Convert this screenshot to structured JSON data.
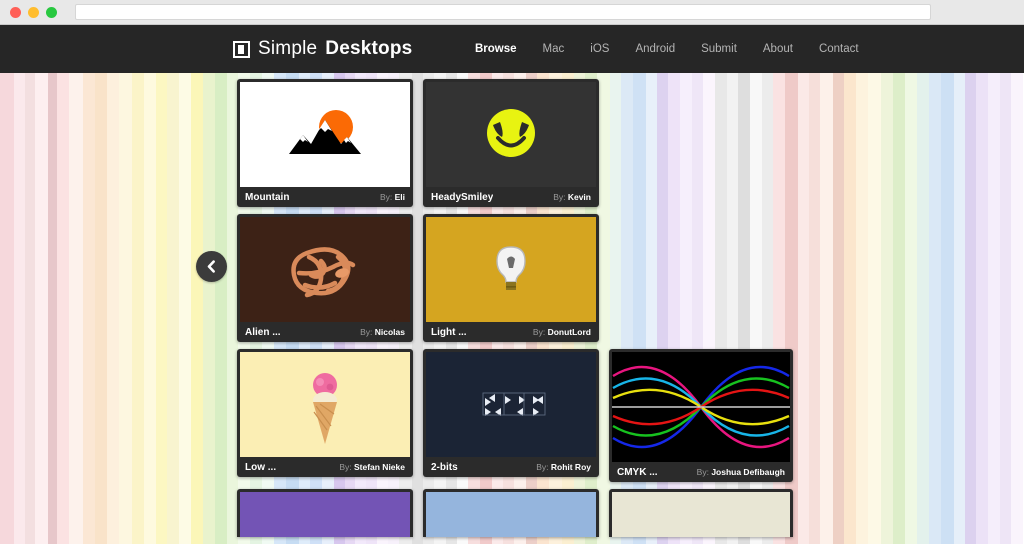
{
  "browser": {
    "traffic_lights": [
      "close",
      "minimize",
      "zoom"
    ],
    "address_value": "",
    "address_placeholder": ""
  },
  "nav": {
    "brand_light": "Simple",
    "brand_bold": "Desktops",
    "brand_icon": "square-window-icon",
    "links": [
      {
        "label": "Browse",
        "active": true
      },
      {
        "label": "Mac",
        "active": false
      },
      {
        "label": "iOS",
        "active": false
      },
      {
        "label": "Android",
        "active": false
      },
      {
        "label": "Submit",
        "active": false
      },
      {
        "label": "About",
        "active": false
      },
      {
        "label": "Contact",
        "active": false
      }
    ]
  },
  "controls": {
    "prev_icon": "chevron-left-icon",
    "prev_label": "Previous"
  },
  "gallery": {
    "by_prefix": "By: ",
    "rows": [
      {
        "items": [
          {
            "title": "Mountain",
            "author": "Eli",
            "art": "mountain",
            "bg": "#ffffff"
          },
          {
            "title": "HeadySmiley",
            "author": "Kevin",
            "art": "smiley",
            "bg": "#333333"
          }
        ]
      },
      {
        "items": [
          {
            "title": "Alien ...",
            "author": "Nicolas",
            "art": "alien",
            "bg": "#3d2216"
          },
          {
            "title": "Light ...",
            "author": "DonutLord",
            "art": "bulb",
            "bg": "#d5a520"
          }
        ]
      },
      {
        "items": [
          {
            "title": "Low ...",
            "author": "Stefan Nieke",
            "art": "icecream",
            "bg": "#fbeeb4"
          },
          {
            "title": "2-bits",
            "author": "Rohit Roy",
            "art": "bits",
            "bg": "#1b2435"
          },
          {
            "title": "CMYK ...",
            "author": "Joshua Defibaugh",
            "art": "cmyk",
            "bg": "#000000"
          }
        ]
      },
      {
        "items": [
          {
            "title": "",
            "author": "",
            "art": "solid",
            "bg": "#7354b5"
          },
          {
            "title": "",
            "author": "",
            "art": "solid",
            "bg": "#95b5dd"
          },
          {
            "title": "",
            "author": "",
            "art": "solid",
            "bg": "#e8e6d4"
          }
        ]
      }
    ]
  },
  "background": {
    "description": "pastel vertical stripes",
    "stripes": [
      {
        "c": "#f6d8dc",
        "w": 14
      },
      {
        "c": "#fbe9ec",
        "w": 10
      },
      {
        "c": "#f3dfe0",
        "w": 10
      },
      {
        "c": "#fdeff0",
        "w": 13
      },
      {
        "c": "#e7c7ca",
        "w": 9
      },
      {
        "c": "#fbe2e2",
        "w": 11
      },
      {
        "c": "#fdf2ec",
        "w": 14
      },
      {
        "c": "#fbe7d4",
        "w": 12
      },
      {
        "c": "#f9e3c9",
        "w": 11
      },
      {
        "c": "#fdf0dd",
        "w": 12
      },
      {
        "c": "#fdf7e0",
        "w": 13
      },
      {
        "c": "#fbf4c8",
        "w": 11
      },
      {
        "c": "#fefadf",
        "w": 12
      },
      {
        "c": "#fcf7c2",
        "w": 11
      },
      {
        "c": "#f8f4cf",
        "w": 11
      },
      {
        "c": "#fdfbe5",
        "w": 12
      },
      {
        "c": "#fbf6b8",
        "w": 12
      },
      {
        "c": "#e9f3cd",
        "w": 11
      },
      {
        "c": "#d8eec4",
        "w": 12
      },
      {
        "c": "#eaf6dc",
        "w": 11
      },
      {
        "c": "#f2faea",
        "w": 12
      },
      {
        "c": "#e4f4e2",
        "w": 11
      },
      {
        "c": "#f0faf3",
        "w": 12
      },
      {
        "c": "#d6e7f8",
        "w": 12
      },
      {
        "c": "#c6dcf3",
        "w": 12
      },
      {
        "c": "#dfecfa",
        "w": 11
      },
      {
        "c": "#cfe0f7",
        "w": 12
      },
      {
        "c": "#e7effb",
        "w": 11
      },
      {
        "c": "#d7c7ee",
        "w": 11
      },
      {
        "c": "#e6d8f4",
        "w": 10
      },
      {
        "c": "#f2e9fb",
        "w": 11
      },
      {
        "c": "#efe4f8",
        "w": 10
      },
      {
        "c": "#faf4fd",
        "w": 11
      },
      {
        "c": "#f7f1fb",
        "w": 11
      },
      {
        "c": "#ededed",
        "w": 12
      },
      {
        "c": "#e0e0e0",
        "w": 11
      },
      {
        "c": "#ebebeb",
        "w": 11
      },
      {
        "c": "#f4f4f4",
        "w": 11
      },
      {
        "c": "#e6e6e6",
        "w": 11
      },
      {
        "c": "#fafafa",
        "w": 11
      },
      {
        "c": "#f7dede",
        "w": 12
      },
      {
        "c": "#f1caca",
        "w": 11
      },
      {
        "c": "#fbeaea",
        "w": 11
      },
      {
        "c": "#f6e0de",
        "w": 11
      },
      {
        "c": "#fcf0ec",
        "w": 11
      },
      {
        "c": "#eccfc8",
        "w": 11
      },
      {
        "c": "#fbe4cf",
        "w": 12
      },
      {
        "c": "#fdf1dc",
        "w": 12
      },
      {
        "c": "#fbefd0",
        "w": 12
      },
      {
        "c": "#eef3d8",
        "w": 11
      },
      {
        "c": "#dfeecb",
        "w": 12
      },
      {
        "c": "#f0f8e3",
        "w": 12
      },
      {
        "c": "#e9f4ef",
        "w": 11
      },
      {
        "c": "#dce9f6",
        "w": 12
      },
      {
        "c": "#cfe1f5",
        "w": 12
      },
      {
        "c": "#e8f0fa",
        "w": 11
      },
      {
        "c": "#ddd2f0",
        "w": 11
      },
      {
        "c": "#eee3f8",
        "w": 11
      },
      {
        "c": "#f6effc",
        "w": 12
      },
      {
        "c": "#efe6f7",
        "w": 11
      },
      {
        "c": "#fbf5fd",
        "w": 11
      },
      {
        "c": "#e8e8e8",
        "w": 12
      },
      {
        "c": "#f2f2f2",
        "w": 11
      },
      {
        "c": "#dedede",
        "w": 12
      },
      {
        "c": "#f8f8f8",
        "w": 11
      },
      {
        "c": "#ececec",
        "w": 11
      },
      {
        "c": "#fae2e2",
        "w": 12
      },
      {
        "c": "#efcac8",
        "w": 12
      },
      {
        "c": "#fbe9e7",
        "w": 11
      },
      {
        "c": "#f6dfda",
        "w": 11
      },
      {
        "c": "#fdf1ea",
        "w": 12
      },
      {
        "c": "#eed0c4",
        "w": 11
      },
      {
        "c": "#fbe6cd",
        "w": 12
      },
      {
        "c": "#fdf3de",
        "w": 12
      },
      {
        "c": "#fdf9e6",
        "w": 12
      },
      {
        "c": "#eef4da",
        "w": 12
      },
      {
        "c": "#ddeec9",
        "w": 12
      },
      {
        "c": "#eff8e4",
        "w": 11
      },
      {
        "c": "#e3f1ec",
        "w": 12
      },
      {
        "c": "#dae8f6",
        "w": 12
      },
      {
        "c": "#cde0f4",
        "w": 12
      },
      {
        "c": "#e6eff9",
        "w": 11
      },
      {
        "c": "#dcd1ef",
        "w": 11
      },
      {
        "c": "#ece2f7",
        "w": 11
      },
      {
        "c": "#f5eefb",
        "w": 12
      },
      {
        "c": "#eee5f6",
        "w": 11
      },
      {
        "c": "#faf4fc",
        "w": 12
      }
    ]
  },
  "chart_data": null
}
